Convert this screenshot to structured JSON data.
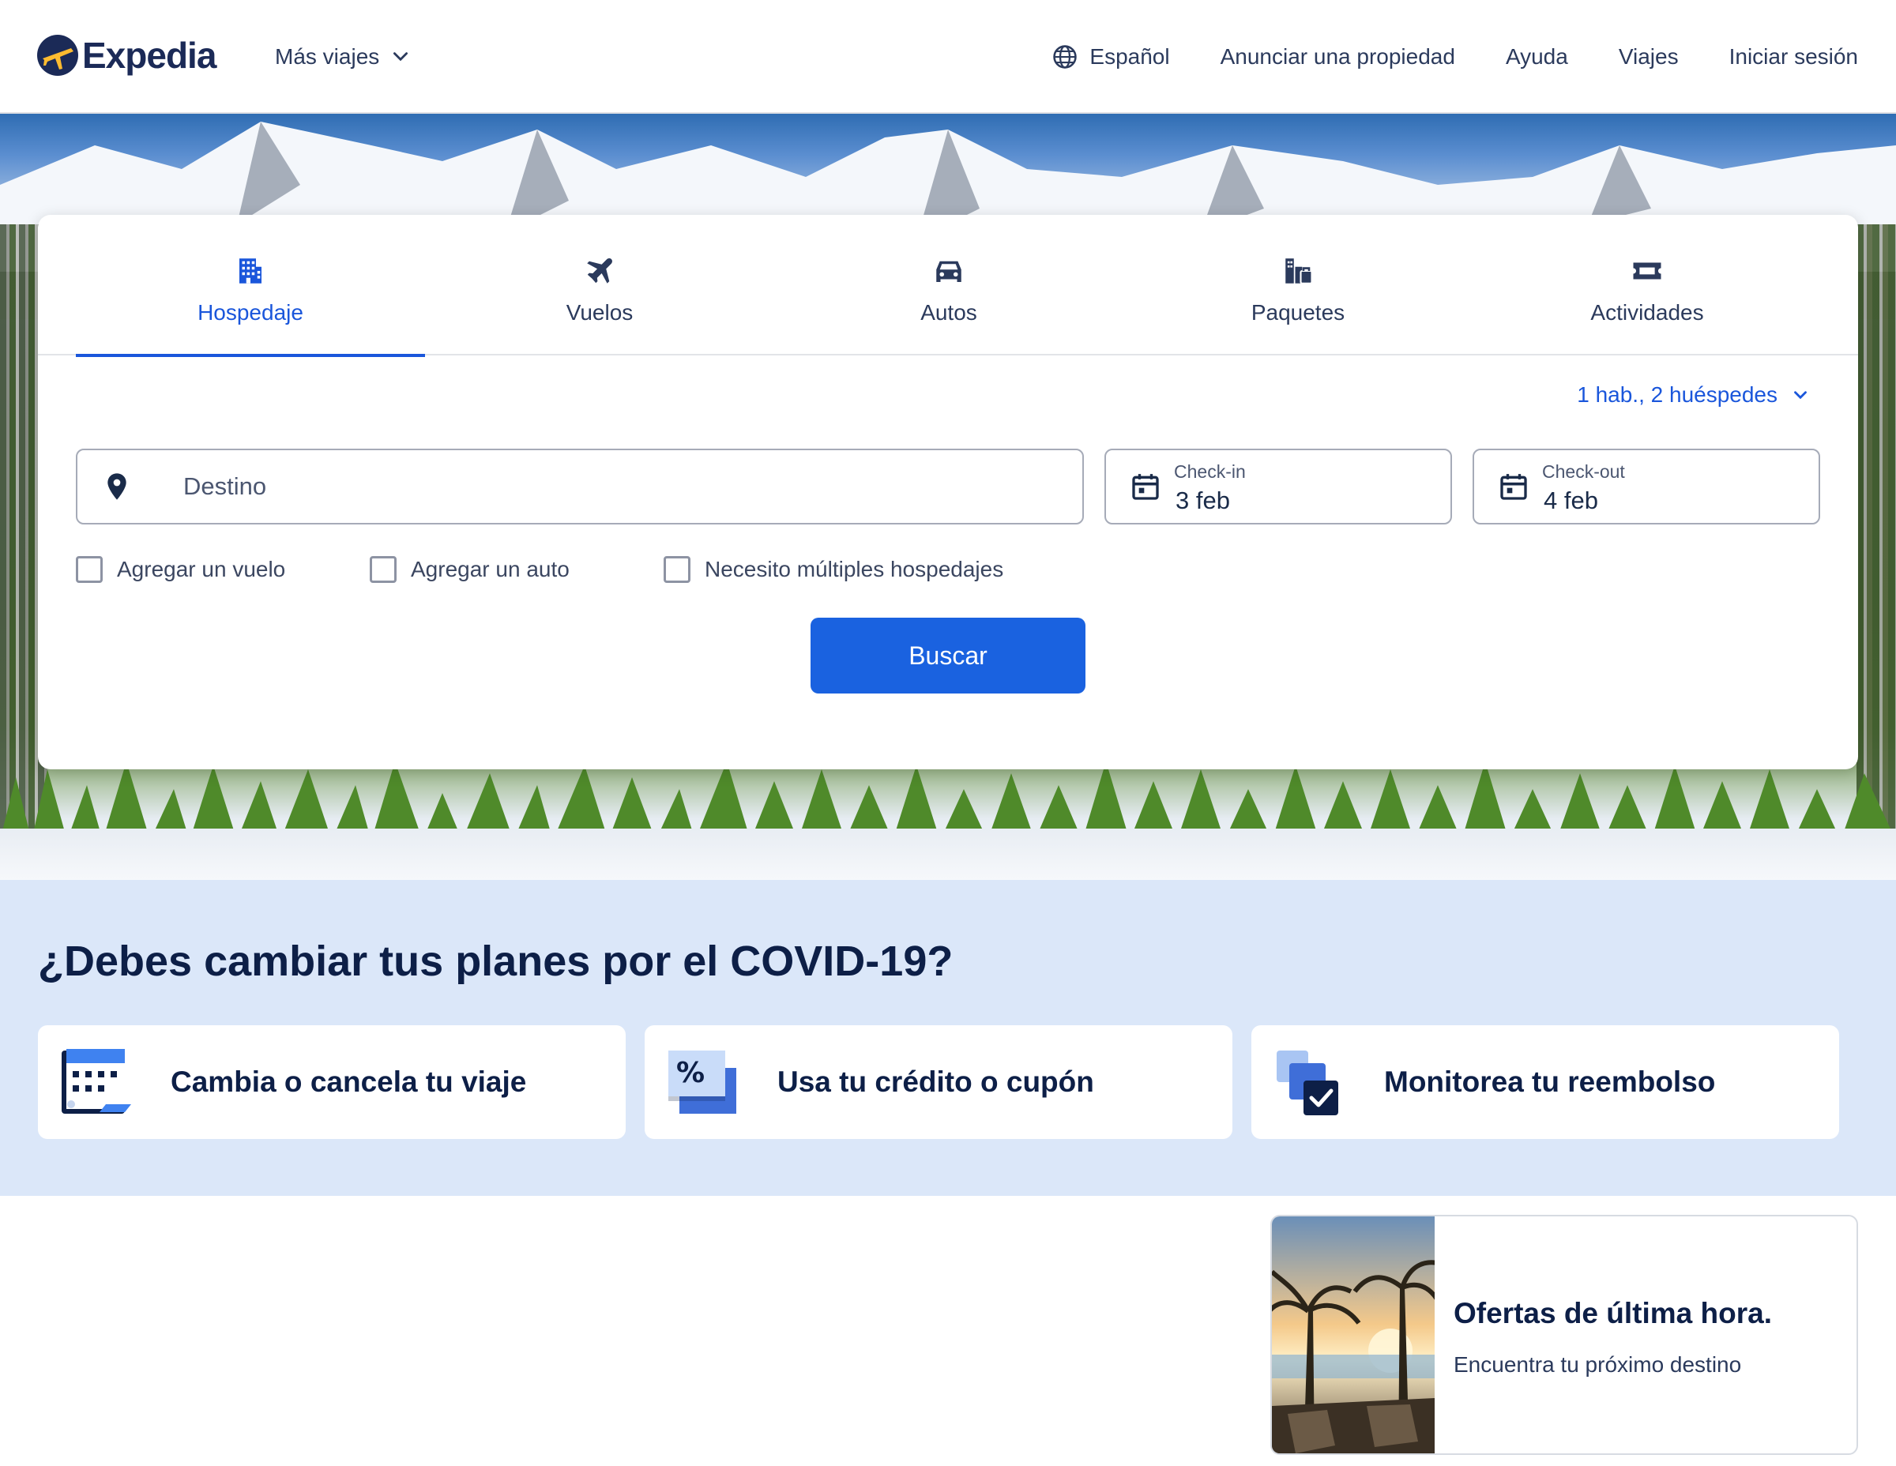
{
  "header": {
    "logo_text": "Expedia",
    "more_trips": "Más viajes",
    "nav": {
      "language": "Español",
      "list_property": "Anunciar una propiedad",
      "help": "Ayuda",
      "trips": "Viajes",
      "sign_in": "Iniciar sesión"
    }
  },
  "search": {
    "tabs": [
      {
        "label": "Hospedaje",
        "icon": "building-icon",
        "active": true
      },
      {
        "label": "Vuelos",
        "icon": "airplane-icon",
        "active": false
      },
      {
        "label": "Autos",
        "icon": "car-icon",
        "active": false
      },
      {
        "label": "Paquetes",
        "icon": "package-icon",
        "active": false
      },
      {
        "label": "Actividades",
        "icon": "ticket-icon",
        "active": false
      }
    ],
    "guests": "1 hab., 2 huéspedes",
    "destination_placeholder": "Destino",
    "checkin": {
      "label": "Check-in",
      "value": "3 feb"
    },
    "checkout": {
      "label": "Check-out",
      "value": "4 feb"
    },
    "checkboxes": [
      {
        "label": "Agregar un vuelo",
        "checked": false
      },
      {
        "label": "Agregar un auto",
        "checked": false
      },
      {
        "label": "Necesito múltiples hospedajes",
        "checked": false
      }
    ],
    "submit": "Buscar"
  },
  "covid": {
    "title": "¿Debes cambiar tus planes por el COVID-19?",
    "cards": [
      {
        "label": "Cambia o cancela tu viaje",
        "icon": "calendar-icon"
      },
      {
        "label": "Usa tu crédito o cupón",
        "icon": "coupon-icon"
      },
      {
        "label": "Monitorea tu reembolso",
        "icon": "refund-check-icon"
      }
    ]
  },
  "promo": {
    "title": "Ofertas de última hora.",
    "subtitle": "Encuentra tu próximo destino"
  },
  "colors": {
    "accent": "#1a62e0",
    "tab_active": "#1a56db",
    "covid_bg": "#dbe7f9",
    "heading": "#0d1f47"
  }
}
